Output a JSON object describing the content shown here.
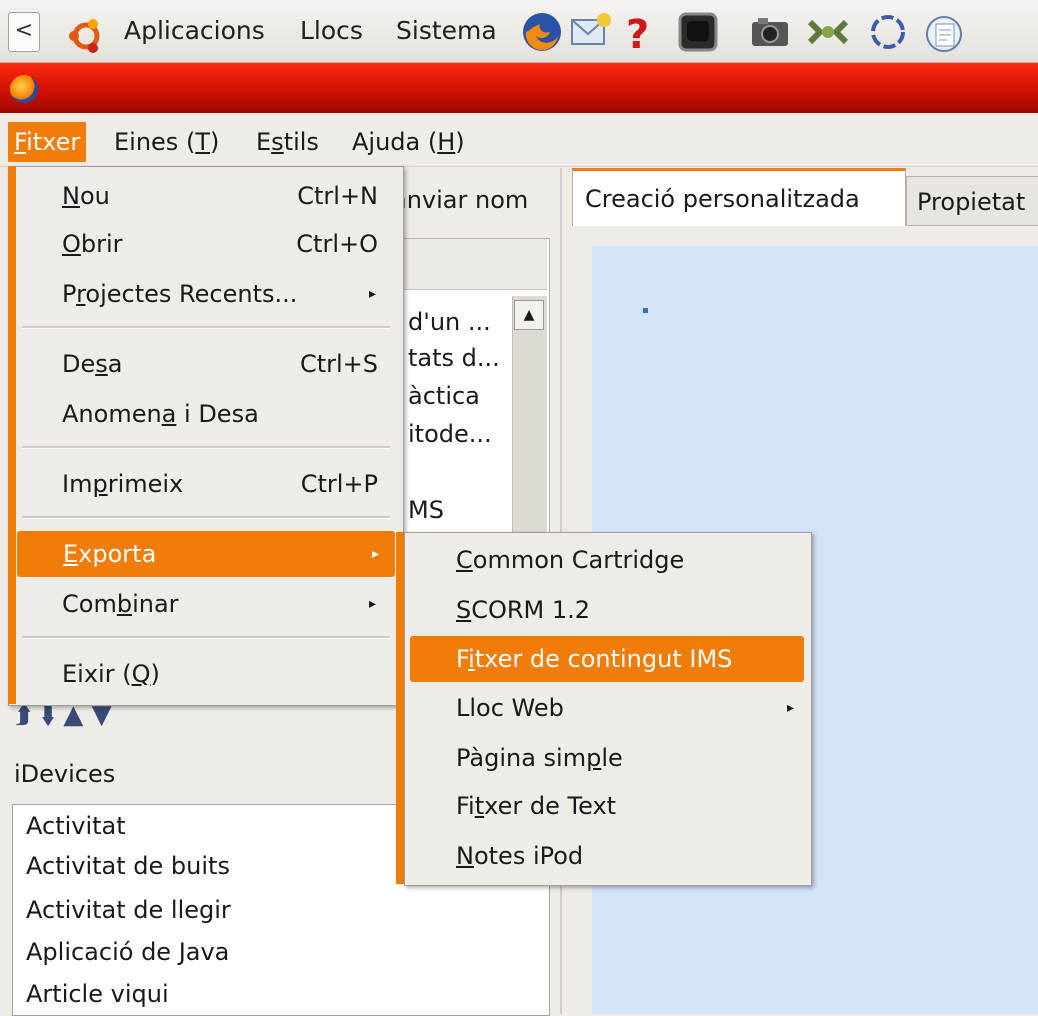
{
  "panel": {
    "scroll_glyph": "<",
    "menus": [
      "Aplicacions",
      "Llocs",
      "Sistema"
    ],
    "launcher_icons": [
      "firefox-icon",
      "mail-icon",
      "help-icon",
      "terminal-icon",
      "camera-icon",
      "network-icon",
      "circle-tool-icon",
      "pidgin-icon"
    ]
  },
  "menubar": {
    "file_prefix": "F",
    "file_rest": "itxer",
    "tools_pre": "Eines (",
    "tools_u": "T",
    "tools_post": ")",
    "styles_pre": "E",
    "styles_u": "s",
    "styles_post": "tils",
    "help_pre": "Ajuda (",
    "help_u": "H",
    "help_post": ")"
  },
  "left_pane": {
    "rename_label": "anviar nom",
    "tree_rows": [
      "d'un ...",
      "tats d...",
      "àctica",
      "itode...",
      "",
      "MS"
    ],
    "nav_arrows": "⮭  ⮯  ▲  ▼",
    "idevices_label": "iDevices",
    "idevices": [
      "Activitat",
      "Activitat de buits",
      "Activitat de llegir",
      "Aplicació de Java",
      "Article viqui"
    ]
  },
  "tabs": {
    "active": "Creació personalitzada",
    "inactive": "Propietat"
  },
  "file_menu": {
    "nou": {
      "pre": "",
      "u": "N",
      "post": "ou",
      "accel": "Ctrl+N"
    },
    "obrir": {
      "pre": "",
      "u": "O",
      "post": "brir",
      "accel": "Ctrl+O"
    },
    "recents": {
      "pre": "P",
      "u": "r",
      "post": "ojectes Recents...",
      "arrow": "▸"
    },
    "desa": {
      "pre": "De",
      "u": "s",
      "post": "a",
      "accel": "Ctrl+S"
    },
    "anomena": {
      "pre": "Anomen",
      "u": "a",
      "post": " i Desa"
    },
    "imprimeix": {
      "pre": "Im",
      "u": "p",
      "post": "rimeix",
      "accel": "Ctrl+P"
    },
    "exporta": {
      "pre": "",
      "u": "E",
      "post": "xporta",
      "arrow": "▸"
    },
    "combinar": {
      "pre": "Com",
      "u": "b",
      "post": "inar",
      "arrow": "▸"
    },
    "eixir": {
      "pre": "Eixir (",
      "u": "Q",
      "post": ")"
    }
  },
  "export_menu": {
    "cc": {
      "pre": "",
      "u": "C",
      "post": "ommon Cartridge"
    },
    "scorm": {
      "pre": "",
      "u": "S",
      "post": "CORM 1.2"
    },
    "ims": {
      "pre": "F",
      "u": "i",
      "post": "txer de contingut IMS"
    },
    "web": {
      "pre": "Lloc Web",
      "u": "",
      "post": "",
      "arrow": "▸"
    },
    "simple": {
      "pre": "Pàgina sim",
      "u": "p",
      "post": "le"
    },
    "text": {
      "pre": "Fi",
      "u": "t",
      "post": "xer de Text"
    },
    "ipod": {
      "pre": "",
      "u": "N",
      "post": "otes iPod"
    }
  },
  "colors": {
    "accent": "#f07c0a",
    "titlebar": "#d81500",
    "canvas": "#d3e3f8"
  }
}
